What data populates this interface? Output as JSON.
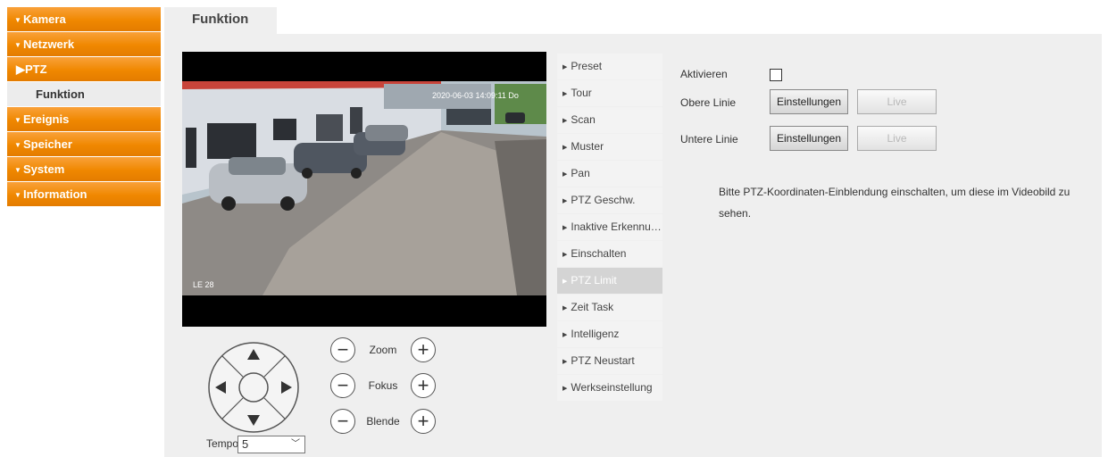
{
  "sidebar": {
    "items": [
      {
        "label": "Kamera"
      },
      {
        "label": "Netzwerk"
      },
      {
        "label": "PTZ"
      },
      {
        "label": "Funktion"
      },
      {
        "label": "Ereignis"
      },
      {
        "label": "Speicher"
      },
      {
        "label": "System"
      },
      {
        "label": "Information"
      }
    ]
  },
  "main": {
    "tab": "Funktion"
  },
  "video": {
    "overlay_timestamp": "2020-06-03 14:09:11 Do",
    "overlay_corner": "LE 28"
  },
  "ptz_controls": {
    "zoom_label": "Zoom",
    "focus_label": "Fokus",
    "iris_label": "Blende",
    "minus_symbol": "−",
    "plus_symbol": "+",
    "tempo_label": "Tempo",
    "tempo_value": "5"
  },
  "function_menu": {
    "items": [
      "Preset",
      "Tour",
      "Scan",
      "Muster",
      "Pan",
      "PTZ Geschw.",
      "Inaktive Erkennung",
      "Einschalten",
      "PTZ Limit",
      "Zeit Task",
      "Intelligenz",
      "PTZ Neustart",
      "Werkseinstellung"
    ],
    "active": "PTZ Limit"
  },
  "settings": {
    "activate_label": "Aktivieren",
    "upper_line_label": "Obere Linie",
    "lower_line_label": "Untere Linie",
    "settings_button": "Einstellungen",
    "live_button": "Live",
    "note": "Bitte PTZ-Koordinaten-Einblendung einschalten, um diese im Videobild zu sehen."
  },
  "colors": {
    "accent": "#f08800",
    "panel": "#efefef"
  }
}
